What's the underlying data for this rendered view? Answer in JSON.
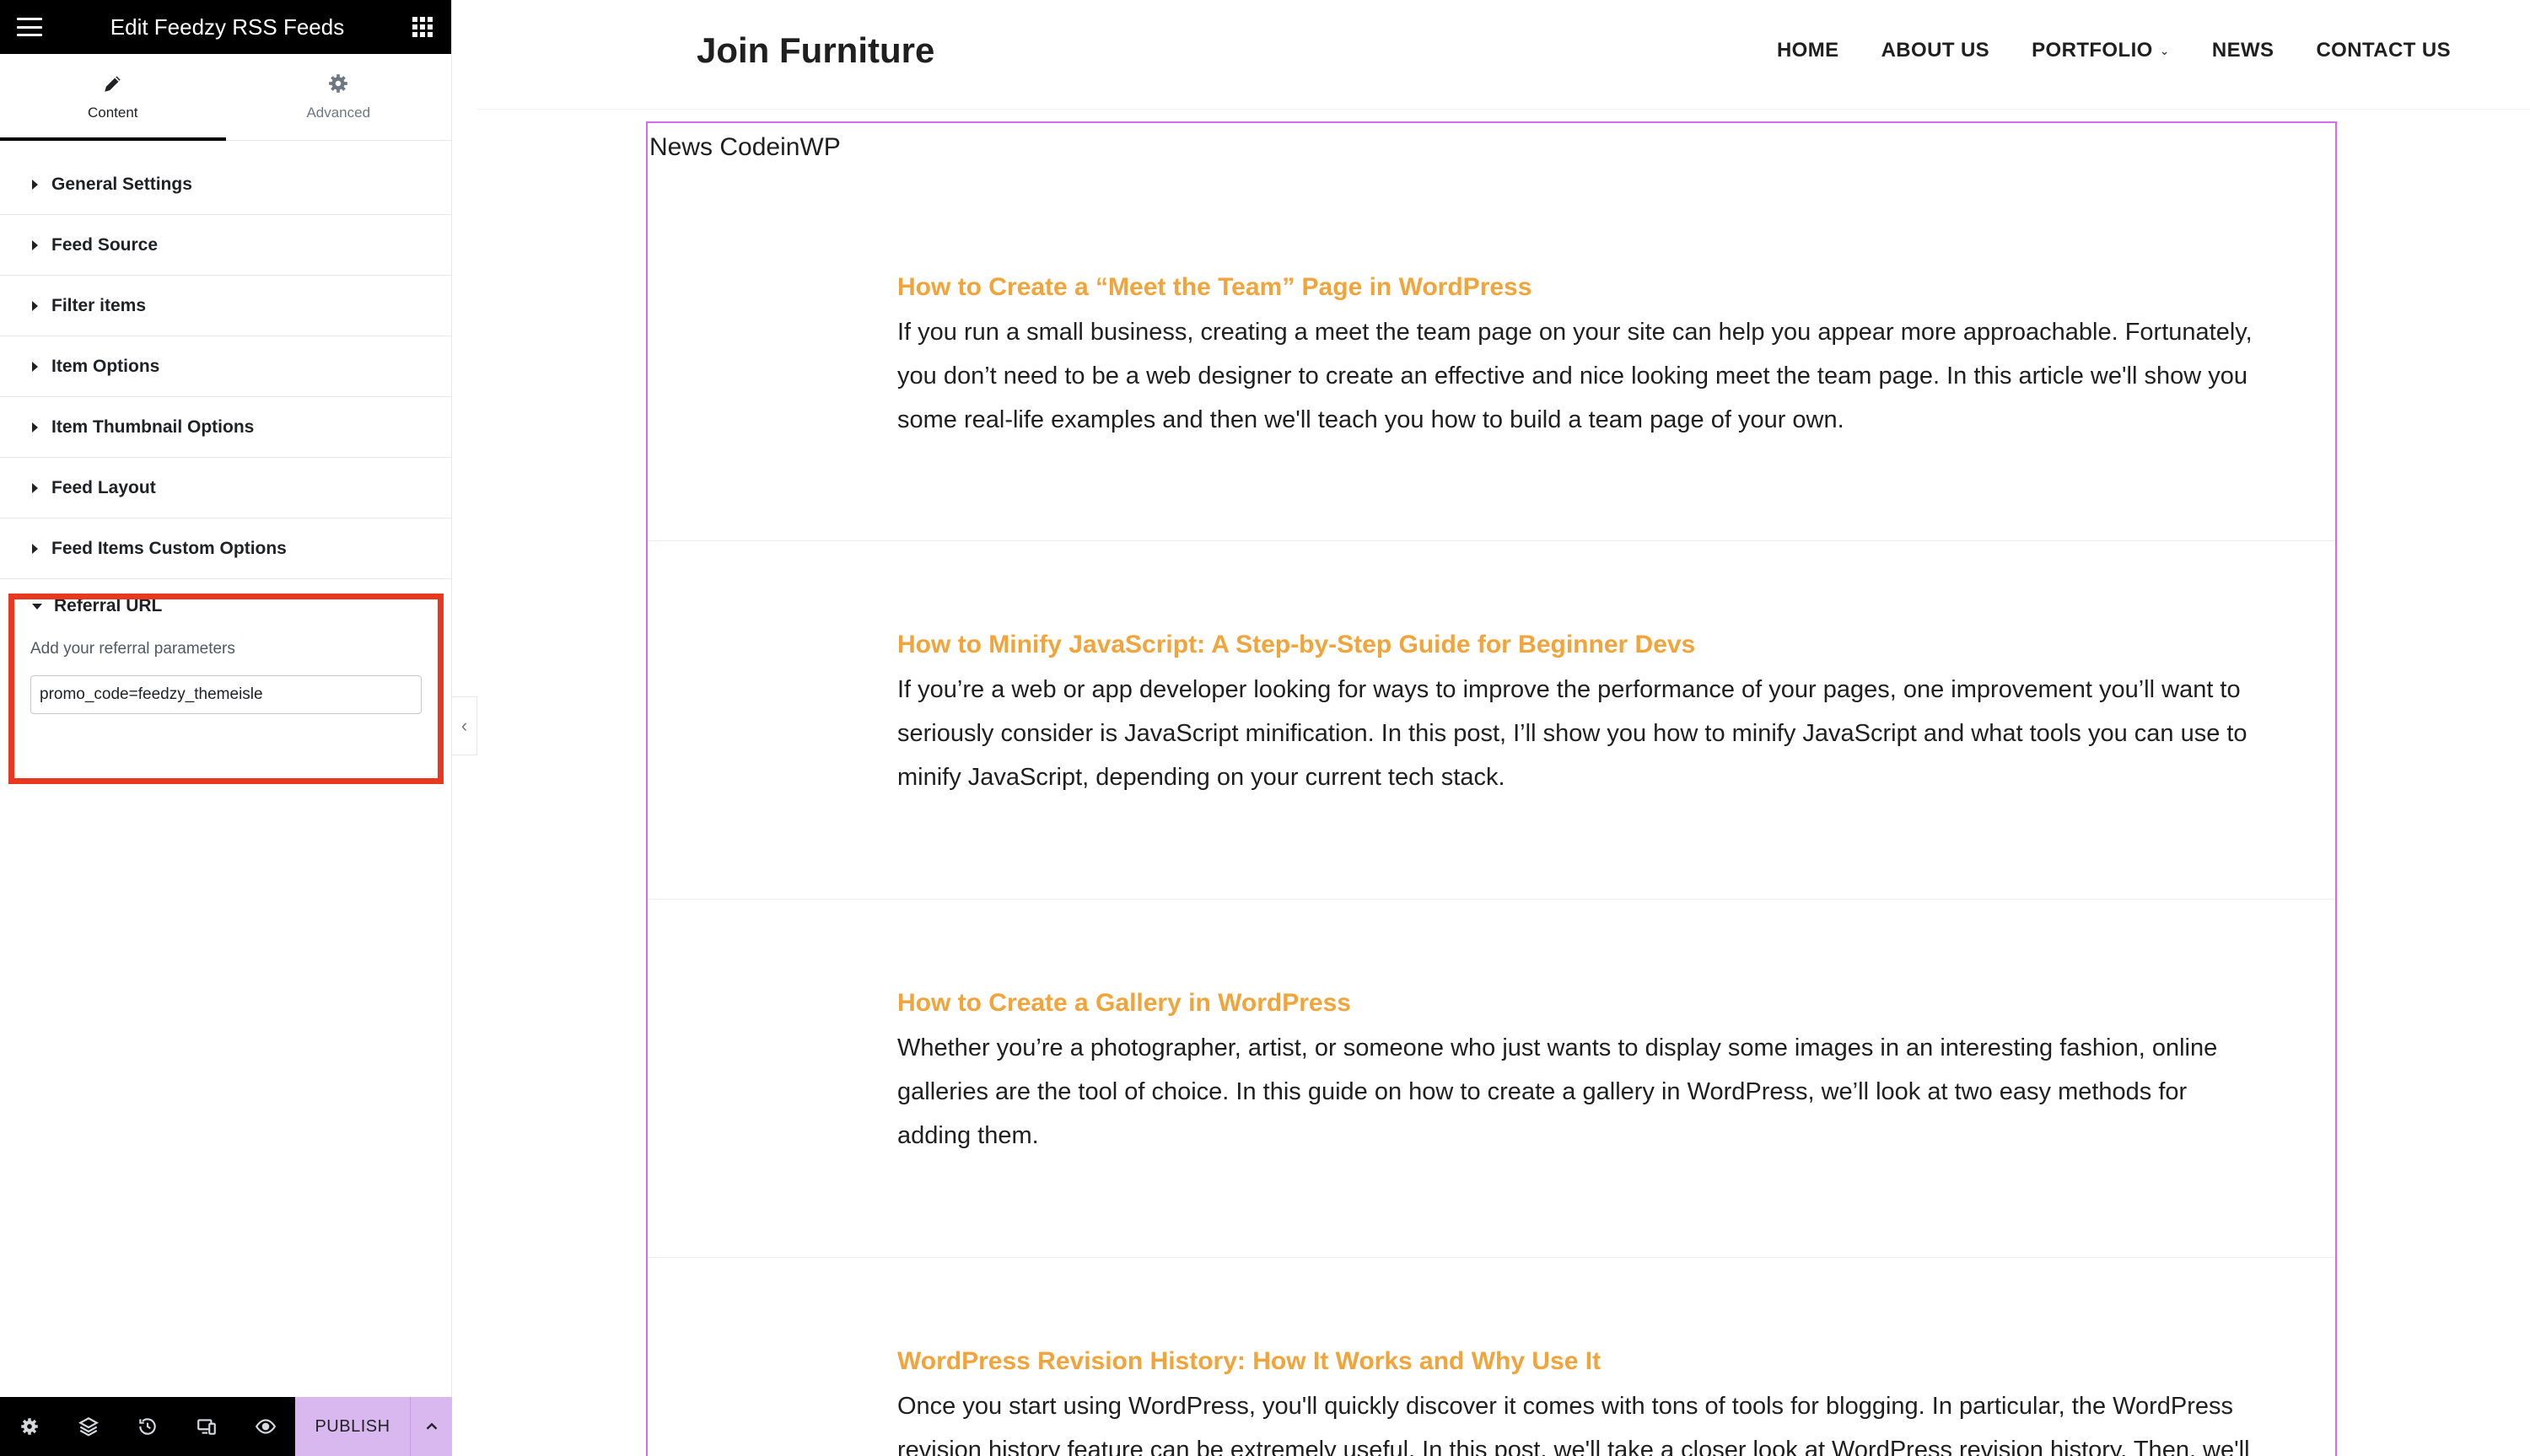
{
  "panel": {
    "title": "Edit Feedzy RSS Feeds",
    "tabs": [
      {
        "label": "Content",
        "icon": "pencil-icon"
      },
      {
        "label": "Advanced",
        "icon": "gear-icon"
      }
    ],
    "sections": [
      {
        "label": "General Settings"
      },
      {
        "label": "Feed Source"
      },
      {
        "label": "Filter items"
      },
      {
        "label": "Item Options"
      },
      {
        "label": "Item Thumbnail Options"
      },
      {
        "label": "Feed Layout"
      },
      {
        "label": "Feed Items Custom Options"
      }
    ],
    "referral": {
      "heading": "Referral URL",
      "field_label": "Add your referral parameters",
      "field_value": "promo_code=feedzy_themeisle"
    },
    "footer": {
      "publish_label": "PUBLISH",
      "icons": [
        "settings-icon",
        "layers-icon",
        "history-icon",
        "responsive-icon",
        "preview-eye-icon"
      ]
    },
    "highlight_color": "#e8381f"
  },
  "site": {
    "title": "Join Furniture",
    "nav": [
      "HOME",
      "ABOUT US",
      "PORTFOLIO",
      "NEWS",
      "CONTACT US"
    ],
    "widget_title": "News CodeinWP",
    "accent_color": "#f1a43a",
    "feed_items": [
      {
        "title": "How to Create a “Meet the Team” Page in WordPress",
        "lines": [
          "If you run a small business, creating a meet the team page on your site can help you appear more approachable. Fortunately,",
          "you don’t need to be a web designer to create an effective and nice looking meet the team page. In this article we'll show you",
          "some real-life examples and then we'll teach you how to build a team page of your own."
        ]
      },
      {
        "title": "How to Minify JavaScript: A Step-by-Step Guide for Beginner Devs",
        "lines": [
          "If you’re a web or app developer looking for ways to improve the performance of your pages, one improvement you’ll want to",
          "seriously consider is JavaScript minification. In this post, I’ll show you how to minify JavaScript and what tools you can use to",
          "minify JavaScript, depending on your current tech stack."
        ]
      },
      {
        "title": "How to Create a Gallery in WordPress",
        "lines": [
          "Whether you’re a photographer, artist, or someone who just wants to display some images in an interesting fashion, online",
          "galleries are the tool of choice. In this guide on how to create a gallery in WordPress, we’ll look at two easy methods for",
          "adding them."
        ]
      },
      {
        "title": "WordPress Revision History: How It Works and Why Use It",
        "lines": [
          "Once you start using WordPress, you'll quickly discover it comes with tons of tools for blogging. In particular, the WordPress",
          "revision history feature can be extremely useful. In this post, we'll take a closer look at WordPress revision history. Then, we'll"
        ]
      }
    ]
  }
}
